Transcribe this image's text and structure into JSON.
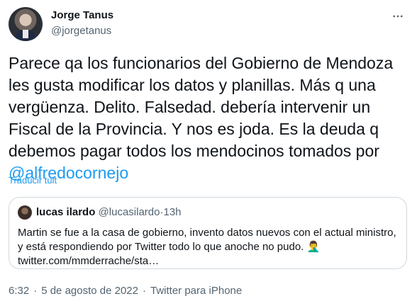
{
  "author": {
    "name": "Jorge Tanus",
    "handle": "@jorgetanus"
  },
  "tweet": {
    "text_before_mention": "Parece qa los funcionarios del Gobierno de Mendoza les gusta modificar los datos y planillas. Más q una vergüenza. Delito. Falsedad. debería intervenir un Fiscal de la Provincia. Y nos es joda. Es la deuda q debemos pagar todos los mendocinos tomados por ",
    "mention": "@alfredocornejo",
    "translate_label": "Traducir tuit"
  },
  "quoted": {
    "name": "lucas ilardo",
    "handle": "@lucasilardo",
    "separator": "·",
    "time": "13h",
    "text": "Martin se fue a la casa de gobierno, invento datos nuevos con el actual ministro, y está respondiendo por Twitter todo lo que anoche no pudo. 🤦‍♂️ twitter.com/mmderrache/sta…"
  },
  "footer": {
    "time": "6:32",
    "separator": "·",
    "date": "5 de agosto de 2022",
    "source": "Twitter para iPhone"
  },
  "icons": {
    "more": "more-horizontal-icon"
  },
  "colors": {
    "accent": "#1d9bf0",
    "muted": "#536471",
    "text": "#0f1419",
    "border": "#cfd9de"
  }
}
